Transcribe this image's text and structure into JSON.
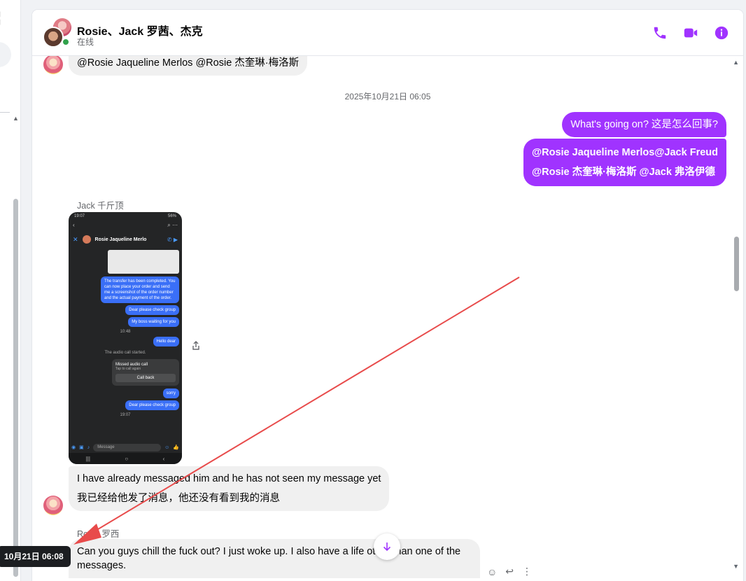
{
  "left": {
    "glyph": "¦"
  },
  "header": {
    "title": "Rosie、Jack  罗茜、杰克",
    "status": "在线",
    "accent": "#a033ff",
    "buttons": [
      {
        "name": "phone-icon"
      },
      {
        "name": "video-icon"
      },
      {
        "name": "info-icon"
      }
    ]
  },
  "messages": {
    "mention_top": "@Rosie Jaqueline Merlos  @Rosie 杰奎琳·梅洛斯",
    "timestamp": "2025年10月21日 06:05",
    "out_1": "What's going on?  这是怎么回事?",
    "out_2_line1": "@Rosie Jaqueline Merlos@Jack Freud",
    "out_2_line2": "@Rosie 杰奎琳·梅洛斯 @Jack 弗洛伊德",
    "jack_name": "Jack  千斤顶",
    "in_1_line1": "I have already messaged him and he has not seen my message yet",
    "in_1_line2": "我已经给他发了消息，他还没有看到我的消息",
    "rosie_name": "Rosie  罗西",
    "in_2": "Can you guys chill the fuck out? I just woke up. I also have a life other than one of the messages."
  },
  "screenshot": {
    "status_time": "19:07",
    "status_right": "56%",
    "contact": "Rosie Jaqueline Merlo",
    "b1": "The transfer has been completed. You can now place your order and send me a screenshot of the order number and the actual payment of the order.",
    "b2": "Dear please check group",
    "b3": "My boss waiting for you",
    "t1": "10:48",
    "b4": "Hello dear",
    "sys": "The audio call started.",
    "missed": "Missed audio call",
    "tap": "Tap to call again",
    "callback": "Call back",
    "b5": "sorry",
    "b6": "Dear please check group",
    "t2": "19:07",
    "compose_placeholder": "Message"
  },
  "tooltip": "10月21日 06:08"
}
